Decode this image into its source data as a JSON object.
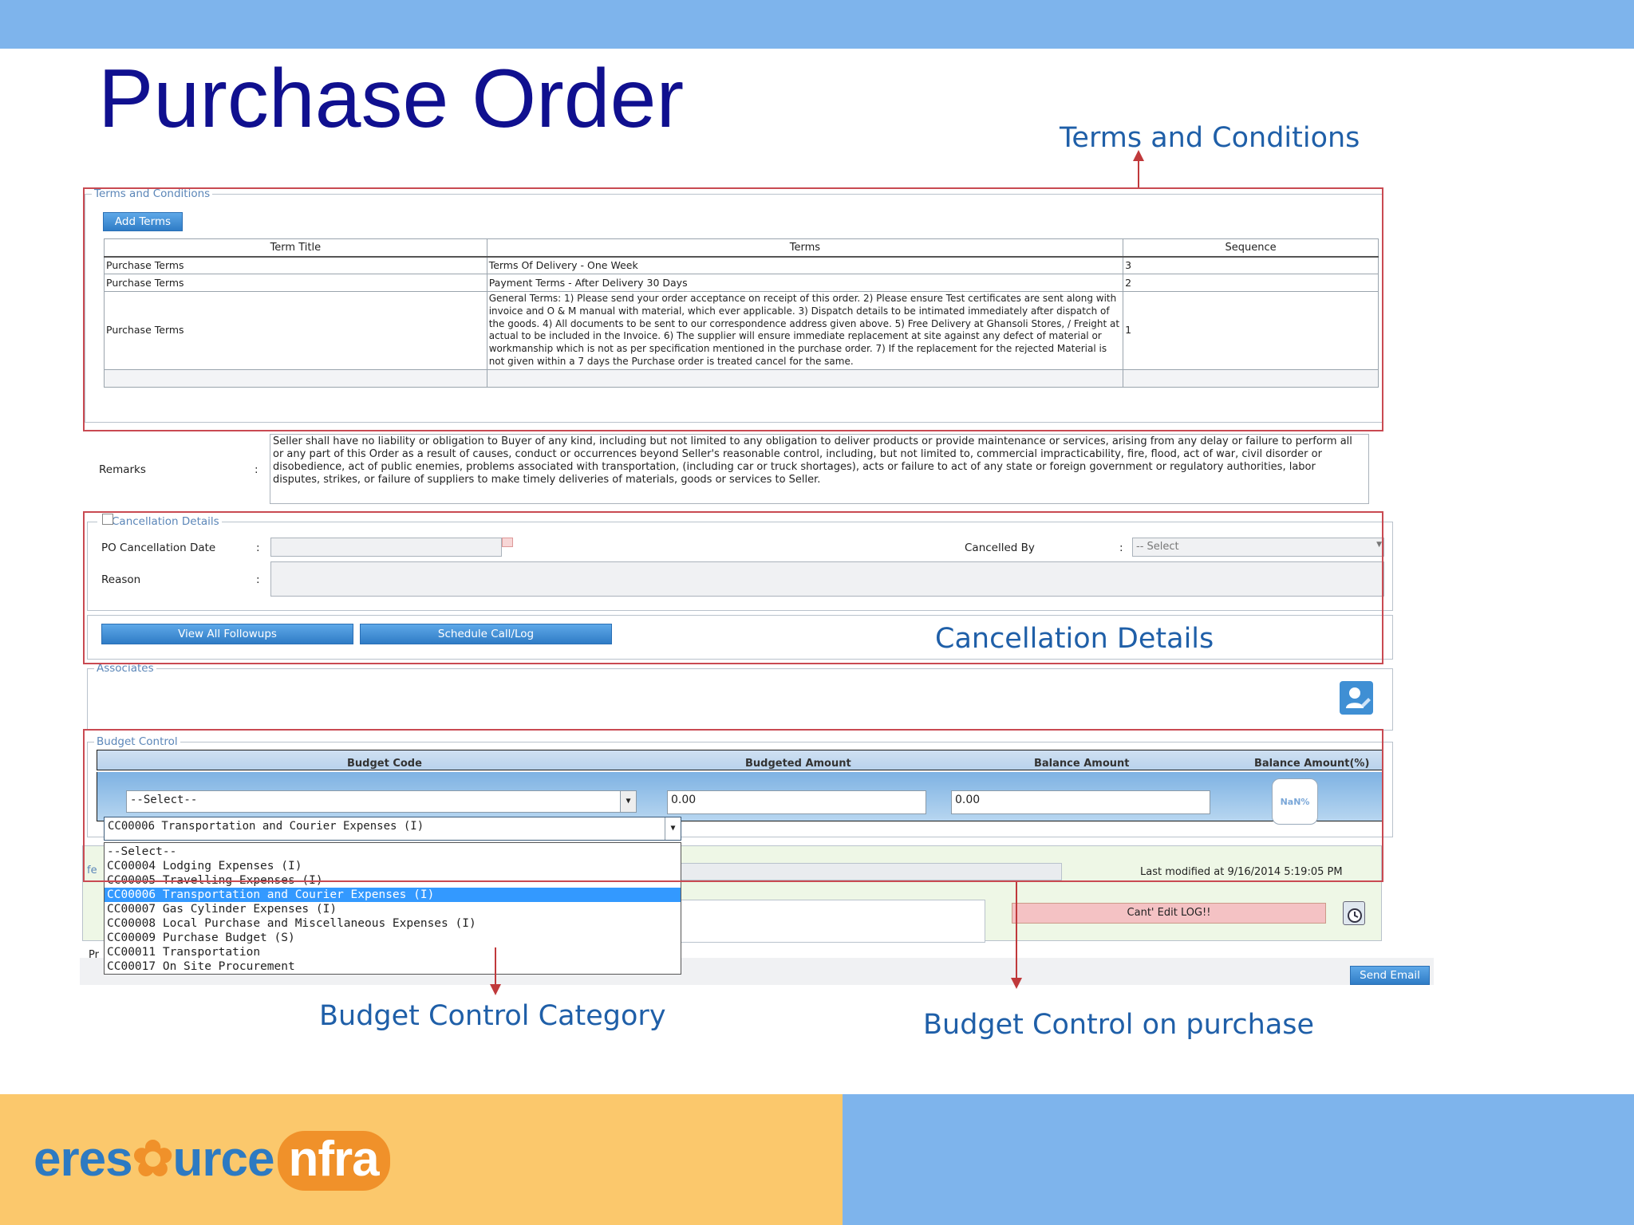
{
  "slide": {
    "title": "Purchase Order"
  },
  "callouts": {
    "terms": "Terms and Conditions",
    "cancellation": "Cancellation Details",
    "budget_category": "Budget Control Category",
    "budget_purchase": "Budget Control on purchase"
  },
  "terms_section": {
    "legend": "Terms and Conditions",
    "add_button": "Add Terms",
    "columns": [
      "Term Title",
      "Terms",
      "Sequence"
    ],
    "rows": [
      {
        "title": "Purchase Terms",
        "terms": "Terms Of Delivery - One Week",
        "sequence": "3"
      },
      {
        "title": "Purchase Terms",
        "terms": "Payment Terms - After Delivery 30 Days",
        "sequence": "2"
      },
      {
        "title": "Purchase Terms",
        "terms": "General Terms: 1) Please send your order acceptance on receipt of this order. 2) Please ensure Test certificates are sent along with invoice and O & M manual with material, which ever applicable. 3) Dispatch details to be intimated immediately after dispatch of the goods. 4) All documents to be sent to our correspondence address given above. 5) Free Delivery at Ghansoli Stores, / Freight at actual to be included in the Invoice. 6) The supplier will ensure immediate replacement at site against any defect of material or workmanship which is not as per specification mentioned in the purchase order. 7) If the replacement for the rejected Material is not given within a 7 days the Purchase order is treated cancel for the same.",
        "sequence": "1"
      }
    ]
  },
  "remarks": {
    "label": "Remarks",
    "colon": ":",
    "text": "Seller shall have no liability or obligation to Buyer of any kind, including but not limited to any obligation to deliver products or provide maintenance or services, arising from any delay or failure to perform all or any part of this Order as a result of causes, conduct or occurrences beyond Seller's reasonable control, including, but not limited to, commercial impracticability, fire, flood, act of war, civil disorder or disobedience, act of public enemies, problems associated with transportation, (including car or truck shortages), acts or failure to act of any state or foreign government or regulatory authorities, labor disputes, strikes, or failure of suppliers to make timely deliveries of materials, goods or services to Seller."
  },
  "cancellation": {
    "legend": "Cancellation Details",
    "date_label": "PO Cancellation Date",
    "cancelled_by_label": "Cancelled By",
    "cancelled_by_value": "-- Select",
    "reason_label": "Reason",
    "colon": ":"
  },
  "followups": {
    "view_all": "View All Followups",
    "schedule": "Schedule Call/Log"
  },
  "associates": {
    "legend": "Associates"
  },
  "budget": {
    "legend": "Budget Control",
    "columns": [
      "Budget Code",
      "Budgeted Amount",
      "Balance Amount",
      "Balance Amount(%)"
    ],
    "code_value": "--Select--",
    "budgeted_amount": "0.00",
    "balance_amount": "0.00",
    "balance_pct": "NaN%",
    "open_select_value": "CC00006 Transportation and Courier Expenses (I)",
    "options": [
      "--Select--",
      "CC00004 Lodging Expenses (I)",
      "CC00005 Travelling Expenses (I)",
      "CC00006 Transportation and Courier Expenses (I)",
      "CC00007 Gas Cylinder Expenses (I)",
      "CC00008 Local Purchase and Miscellaneous Expenses (I)",
      "CC00009 Purchase Budget (S)",
      "CC00011 Transportation",
      "CC00017 On Site Procurement"
    ],
    "selected_index": 3
  },
  "log": {
    "last_modified": "Last modified at 9/16/2014 5:19:05 PM",
    "cant_edit": "Cant' Edit LOG!!",
    "send_email": "Send Email",
    "partial_fe": "fe",
    "partial_pr": "Pr"
  },
  "footer": {
    "logo_part1": "eres",
    "logo_part2": "urce",
    "logo_part3": "nfra"
  },
  "colors": {
    "band": "#7eb4ec",
    "title": "#10108f",
    "callout": "#1f5fa8",
    "highlight": "#c94a52",
    "footer_left": "#fbc86c"
  }
}
